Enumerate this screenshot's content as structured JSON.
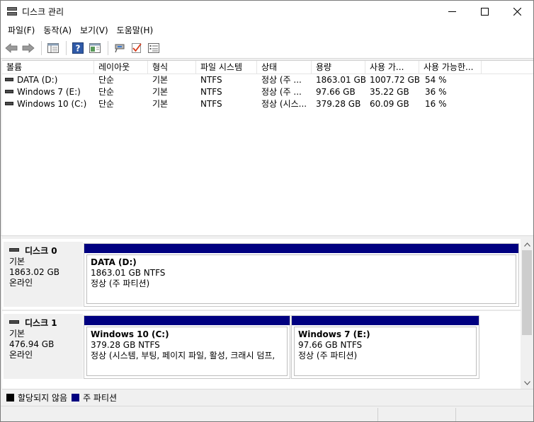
{
  "window": {
    "title": "디스크 관리",
    "minimize": "—",
    "maximize": "☐",
    "close": "✕"
  },
  "menu": [
    {
      "label": "파일(F)"
    },
    {
      "label": "동작(A)"
    },
    {
      "label": "보기(V)"
    },
    {
      "label": "도움말(H)"
    }
  ],
  "toolbar": {
    "icons": [
      "back-arrow-icon",
      "forward-arrow-icon",
      "console-tree-icon",
      "help-icon",
      "action-pane-icon",
      "connect-icon",
      "checkmark-icon",
      "properties-icon"
    ]
  },
  "columns": [
    "볼륨",
    "레이아웃",
    "형식",
    "파일 시스템",
    "상태",
    "용량",
    "사용 가...",
    "사용 가능한..."
  ],
  "volumes": [
    {
      "name": "DATA (D:)",
      "layout": "단순",
      "type": "기본",
      "fs": "NTFS",
      "status": "정상 (주 ...",
      "capacity": "1863.01 GB",
      "free": "1007.72 GB",
      "pct": "54 %"
    },
    {
      "name": "Windows 7 (E:)",
      "layout": "단순",
      "type": "기본",
      "fs": "NTFS",
      "status": "정상 (주 ...",
      "capacity": "97.66 GB",
      "free": "35.22 GB",
      "pct": "36 %"
    },
    {
      "name": "Windows 10 (C:)",
      "layout": "단순",
      "type": "기본",
      "fs": "NTFS",
      "status": "정상 (시스...",
      "capacity": "379.28 GB",
      "free": "60.09 GB",
      "pct": "16 %"
    }
  ],
  "disks": [
    {
      "name": "디스크 0",
      "type": "기본",
      "size": "1863.02 GB",
      "state": "온라인",
      "partitions": [
        {
          "title": "DATA  (D:)",
          "size": "1863.01 GB NTFS",
          "status": "정상 (주 파티션)"
        }
      ]
    },
    {
      "name": "디스크 1",
      "type": "기본",
      "size": "476.94 GB",
      "state": "온라인",
      "partitions": [
        {
          "title": "Windows 10  (C:)",
          "size": "379.28 GB NTFS",
          "status": "정상 (시스템, 부팅, 페이지 파일, 활성, 크래시 덤프,"
        },
        {
          "title": "Windows 7  (E:)",
          "size": "97.66 GB NTFS",
          "status": "정상 (주 파티션)"
        }
      ]
    }
  ],
  "legend": [
    {
      "label": "할당되지 않음",
      "color": "#000000"
    },
    {
      "label": "주 파티션",
      "color": "#000080"
    }
  ],
  "colors": {
    "partition_bar": "#000080"
  }
}
